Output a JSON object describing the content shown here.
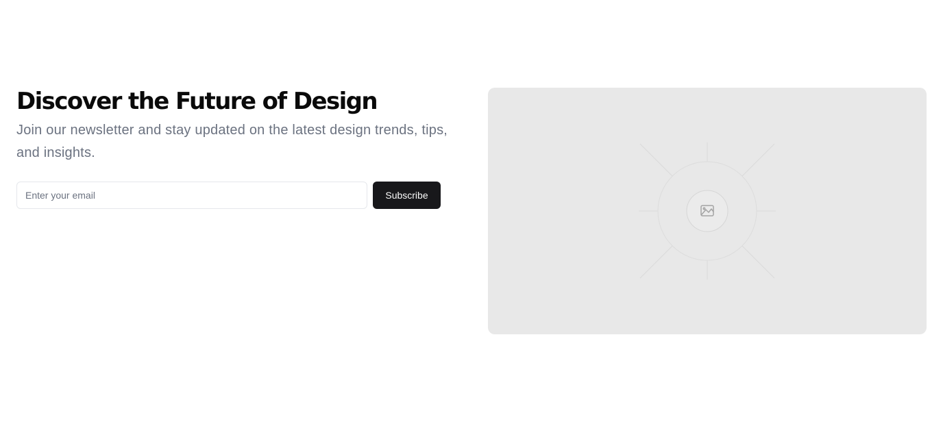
{
  "hero": {
    "headline": "Discover the Future of Design",
    "subtext": "Join our newsletter and stay updated on the latest design trends, tips, and insights."
  },
  "form": {
    "email_placeholder": "Enter your email",
    "email_value": "",
    "subscribe_label": "Subscribe"
  },
  "media": {
    "icon": "image-icon",
    "background_color": "#e8e8e8"
  },
  "colors": {
    "button_bg": "#18181b",
    "button_text": "#fafafa",
    "headline": "#0a0a0a",
    "subtext": "#6b7280"
  }
}
